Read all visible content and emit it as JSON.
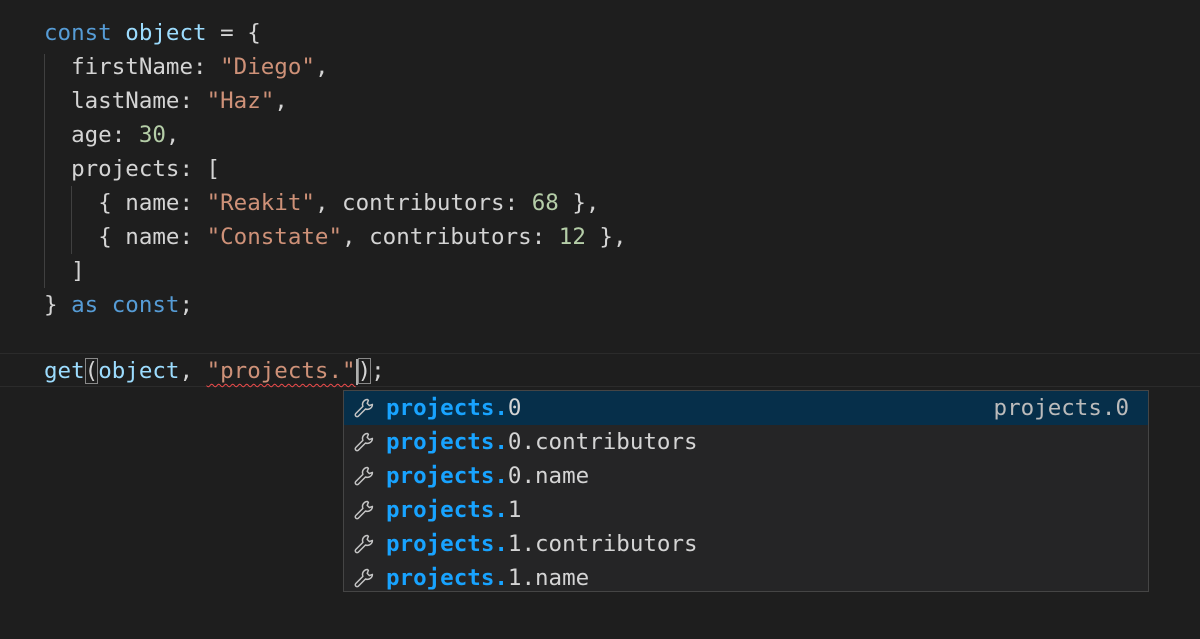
{
  "code": {
    "line1": {
      "kw": "const",
      "var": "object",
      "rest": " = {"
    },
    "line2": {
      "prop": "firstName",
      "colon": ": ",
      "str": "\"Diego\"",
      "tail": ","
    },
    "line3": {
      "prop": "lastName",
      "colon": ": ",
      "str": "\"Haz\"",
      "tail": ","
    },
    "line4": {
      "prop": "age",
      "colon": ": ",
      "num": "30",
      "tail": ","
    },
    "line5": {
      "prop": "projects",
      "rest": ": ["
    },
    "line6": {
      "open": "{ ",
      "p1": "name",
      "c1": ": ",
      "s1": "\"Reakit\"",
      "sep": ", ",
      "p2": "contributors",
      "c2": ": ",
      "n1": "68",
      "close": " },"
    },
    "line7": {
      "open": "{ ",
      "p1": "name",
      "c1": ": ",
      "s1": "\"Constate\"",
      "sep": ", ",
      "p2": "contributors",
      "c2": ": ",
      "n1": "12",
      "close": " },"
    },
    "line8": {
      "text": "]"
    },
    "line9": {
      "brace": "} ",
      "kw1": "as",
      "sp": " ",
      "kw2": "const",
      "semi": ";"
    },
    "line10": {
      "fn": "get",
      "open": "(",
      "arg1": "object",
      "sep": ", ",
      "str": "\"projects.\"",
      "close": ")",
      "semi": ";"
    }
  },
  "suggest": {
    "match_text": "projects.",
    "items": [
      {
        "suffix": "0",
        "detail": "projects.0",
        "icon": "wrench-icon"
      },
      {
        "suffix": "0.contributors",
        "icon": "wrench-icon"
      },
      {
        "suffix": "0.name",
        "icon": "wrench-icon"
      },
      {
        "suffix": "1",
        "icon": "wrench-icon"
      },
      {
        "suffix": "1.contributors",
        "icon": "wrench-icon"
      },
      {
        "suffix": "1.name",
        "icon": "wrench-icon"
      }
    ]
  },
  "colors": {
    "background": "#1e1e1e",
    "keyword": "#569cd6",
    "string": "#ce9178",
    "number": "#b5cea8",
    "match_highlight": "#18a3ff",
    "selected_row": "#062f4a",
    "error_squiggle": "#f14c4c"
  }
}
